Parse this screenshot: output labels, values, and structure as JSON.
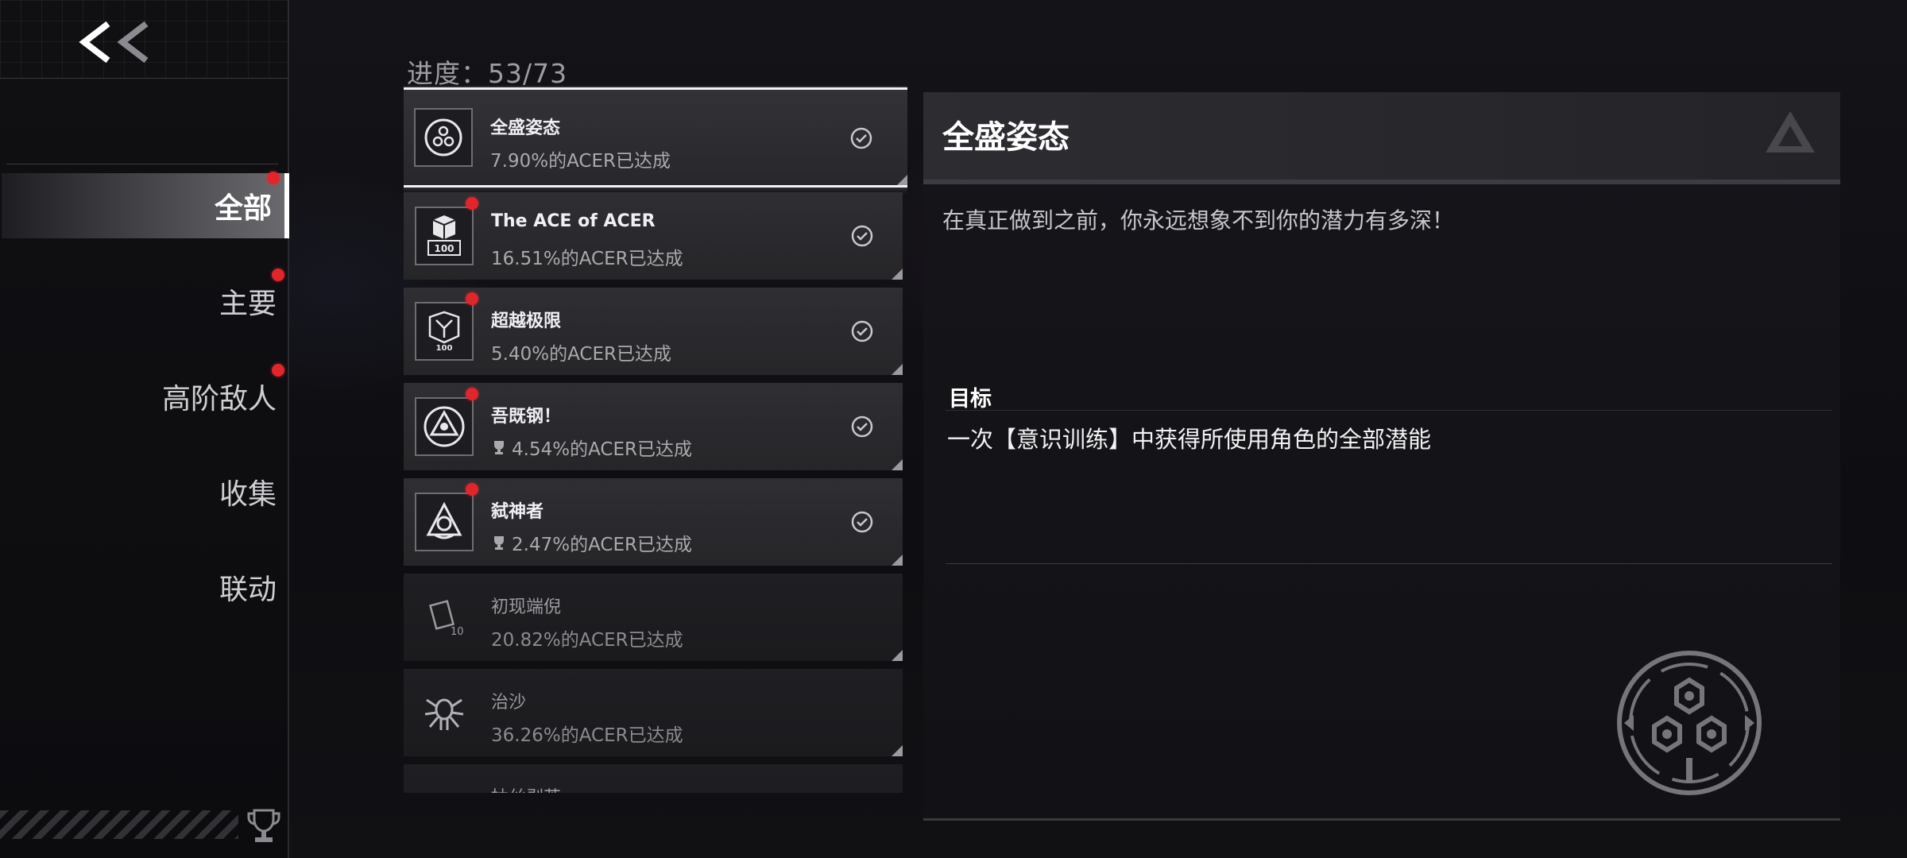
{
  "sidebar": {
    "back_icon": "double-chevron-left-icon",
    "items": [
      {
        "label": "全部",
        "active": true,
        "has_dot": true
      },
      {
        "label": "主要",
        "active": false,
        "has_dot": true
      },
      {
        "label": "高阶敌人",
        "active": false,
        "has_dot": true
      },
      {
        "label": "收集",
        "active": false,
        "has_dot": false
      },
      {
        "label": "联动",
        "active": false,
        "has_dot": false
      }
    ],
    "trophy_icon": "trophy-icon"
  },
  "progress": {
    "text": "进度：53/73"
  },
  "achievements": [
    {
      "title": "全盛姿态",
      "rate": "7.90%的ACER已达成",
      "icon": "hex-emblem-icon",
      "completed": true,
      "selected": true,
      "new": false,
      "trophy": false
    },
    {
      "title": "The ACE of ACER",
      "rate": "16.51%的ACER已达成",
      "icon": "cube-100-icon",
      "completed": true,
      "selected": false,
      "new": true,
      "trophy": false
    },
    {
      "title": "超越极限",
      "rate": "5.40%的ACER已达成",
      "icon": "cube-100-gem-icon",
      "completed": true,
      "selected": false,
      "new": true,
      "trophy": false
    },
    {
      "title": "吾既钢！",
      "rate": "4.54%的ACER已达成",
      "icon": "triangle-emblem-icon",
      "completed": true,
      "selected": false,
      "new": true,
      "trophy": true
    },
    {
      "title": "弑神者",
      "rate": "2.47%的ACER已达成",
      "icon": "crown-emblem-icon",
      "completed": true,
      "selected": false,
      "new": true,
      "trophy": true
    },
    {
      "title": "初现端倪",
      "rate": "20.82%的ACER已达成",
      "icon": "card-10-icon",
      "completed": false,
      "selected": false,
      "new": false,
      "trophy": false
    },
    {
      "title": "治沙",
      "rate": "36.26%的ACER已达成",
      "icon": "spider-icon",
      "completed": false,
      "selected": false,
      "new": false,
      "trophy": false
    },
    {
      "title": "抽丝剥茧",
      "rate": "",
      "icon": "generic-icon",
      "completed": false,
      "selected": false,
      "new": false,
      "trophy": false
    }
  ],
  "detail": {
    "title": "全盛姿态",
    "description": "在真正做到之前，你永远想象不到你的潜力有多深！",
    "goal_label": "目标",
    "goal_text": "一次【意识训练】中获得所使用角色的全部潜能",
    "badge_icon": "hex-emblem-large-icon"
  },
  "colors": {
    "accent_red": "#e0262b",
    "selected_border": "#f2f2f4"
  }
}
